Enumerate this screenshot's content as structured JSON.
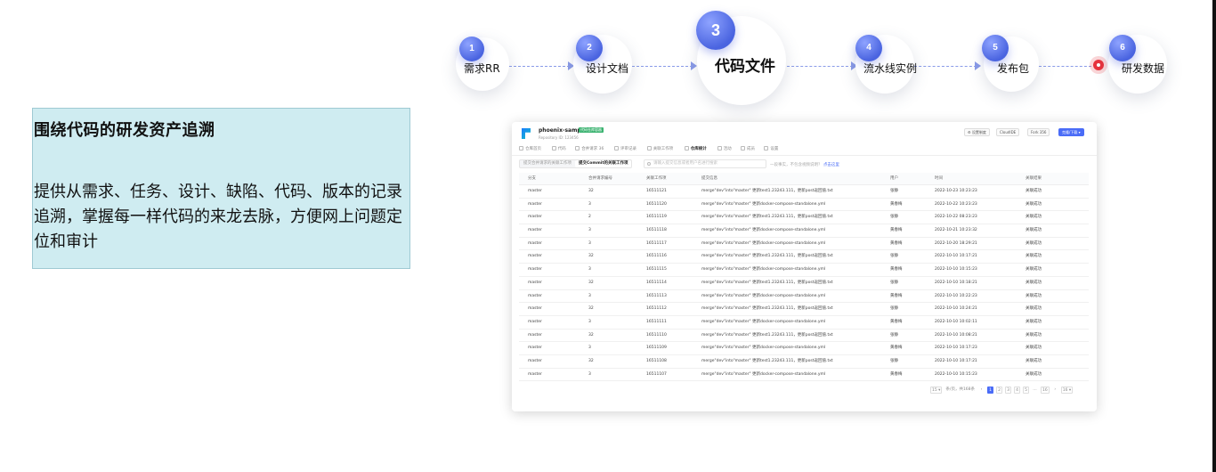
{
  "flow": {
    "steps": [
      {
        "num": "1",
        "label": "需求RR"
      },
      {
        "num": "2",
        "label": "设计文档"
      },
      {
        "num": "3",
        "label": "代码文件"
      },
      {
        "num": "4",
        "label": "流水线实例"
      },
      {
        "num": "5",
        "label": "发布包"
      },
      {
        "num": "6",
        "label": "研发数据"
      }
    ],
    "accent": "#4a64e0",
    "marker_color": "#e8323c"
  },
  "panel": {
    "title": "围绕代码的研发资产追溯",
    "description": "提供从需求、任务、设计、缺陷、代码、版本的记录追溯，掌握每一样代码的来龙去脉，方便网上问题定位和审计"
  },
  "app": {
    "repo_name": "phoenix-sample",
    "repo_tag": "代码仓库容器",
    "repo_sub": "Repository ID: 123456",
    "header_buttons": [
      {
        "icon": "gear-icon",
        "label": "设置制度"
      },
      {
        "icon": "cloud-icon",
        "label": "CloudIDE"
      },
      {
        "icon": "fork-icon",
        "label": "Fork",
        "count": "356"
      },
      {
        "icon": "clone-icon",
        "label": "克隆/下载"
      }
    ],
    "tabs": [
      "仓库首页",
      "代码",
      "合并请求",
      "评审记录",
      "关联工作项",
      "仓库统计",
      "活动",
      "成员",
      "设置"
    ],
    "tab_counts": [
      "",
      "",
      "36",
      "",
      "",
      "",
      "",
      "",
      ""
    ],
    "active_tab": 5,
    "segments": [
      "提交合并请求的关联工作项",
      "提交Commit的关联工作项"
    ],
    "active_segment": 1,
    "search_placeholder": "请输入提交信息或者用户名进行搜索",
    "hint_text": "一段事实，不包含视频说明？",
    "hint_link": "点击这里",
    "columns": [
      "分支",
      "合并请求编号",
      "关联工作项",
      "提交信息",
      "用户",
      "时间",
      "关联结果"
    ],
    "rows": [
      [
        "master",
        "32",
        "16511121",
        "merge\"dev\"into\"master\" 更新test1.23243.111，更新post返回值.txt",
        "张静",
        "2022-10-23 10:23:23",
        "关联成功"
      ],
      [
        "master",
        "3",
        "16511120",
        "merge\"dev\"into\"master\" 更新docker-compose-standalone.yml",
        "黄春梅",
        "2022-10-22 10:23:23",
        "关联成功"
      ],
      [
        "master",
        "2",
        "16511119",
        "merge\"dev\"into\"master\" 更新test1.23243.111，更新post返回值.txt",
        "张静",
        "2022-10-22 08:23:23",
        "关联成功"
      ],
      [
        "master",
        "3",
        "16511118",
        "merge\"dev\"into\"master\" 更新docker-compose-standalone.yml",
        "黄春梅",
        "2022-10-21 10:23:32",
        "关联成功"
      ],
      [
        "master",
        "3",
        "16511117",
        "merge\"dev\"into\"master\" 更新docker-compose-standalone.yml",
        "黄春梅",
        "2022-10-20 18:29:21",
        "关联成功"
      ],
      [
        "master",
        "32",
        "16511116",
        "merge\"dev\"into\"master\" 更新test1.23243.111，更新post返回值.txt",
        "张静",
        "2022-10-10 10:17:21",
        "关联成功"
      ],
      [
        "master",
        "3",
        "16511115",
        "merge\"dev\"into\"master\" 更新docker-compose-standalone.yml",
        "黄春梅",
        "2022-10-10 10:15:23",
        "关联成功"
      ],
      [
        "master",
        "32",
        "16511114",
        "merge\"dev\"into\"master\" 更新test1.23243.111，更新post返回值.txt",
        "张静",
        "2022-10-10 10:18:21",
        "关联成功"
      ],
      [
        "master",
        "3",
        "16511113",
        "merge\"dev\"into\"master\" 更新docker-compose-standalone.yml",
        "黄春梅",
        "2022-10-10 10:22:23",
        "关联成功"
      ],
      [
        "master",
        "32",
        "16511112",
        "merge\"dev\"into\"master\" 更新test1.23243.111，更新post返回值.txt",
        "张静",
        "2022-10-10 10:24:21",
        "关联成功"
      ],
      [
        "master",
        "3",
        "16511111",
        "merge\"dev\"into\"master\" 更新docker-compose-standalone.yml",
        "黄春梅",
        "2022-10-10 10:02:11",
        "关联成功"
      ],
      [
        "master",
        "32",
        "16511110",
        "merge\"dev\"into\"master\" 更新test1.23243.111，更新post返回值.txt",
        "张静",
        "2022-10-10 10:08:21",
        "关联成功"
      ],
      [
        "master",
        "3",
        "16511109",
        "merge\"dev\"into\"master\" 更新docker-compose-standalone.yml",
        "黄春梅",
        "2022-10-10 10:17:23",
        "关联成功"
      ],
      [
        "master",
        "32",
        "16511108",
        "merge\"dev\"into\"master\" 更新test1.23243.111，更新post返回值.txt",
        "张静",
        "2022-10-10 10:17:21",
        "关联成功"
      ],
      [
        "master",
        "3",
        "16511107",
        "merge\"dev\"into\"master\" 更新docker-compose-standalone.yml",
        "黄春梅",
        "2022-10-10 10:15:23",
        "关联成功"
      ]
    ],
    "pager": {
      "page_size": "15",
      "total_text": "条/页，共168条",
      "pages": [
        "1",
        "2",
        "3",
        "4",
        "5",
        "…",
        "16"
      ],
      "current": "1",
      "jump": "16"
    }
  }
}
